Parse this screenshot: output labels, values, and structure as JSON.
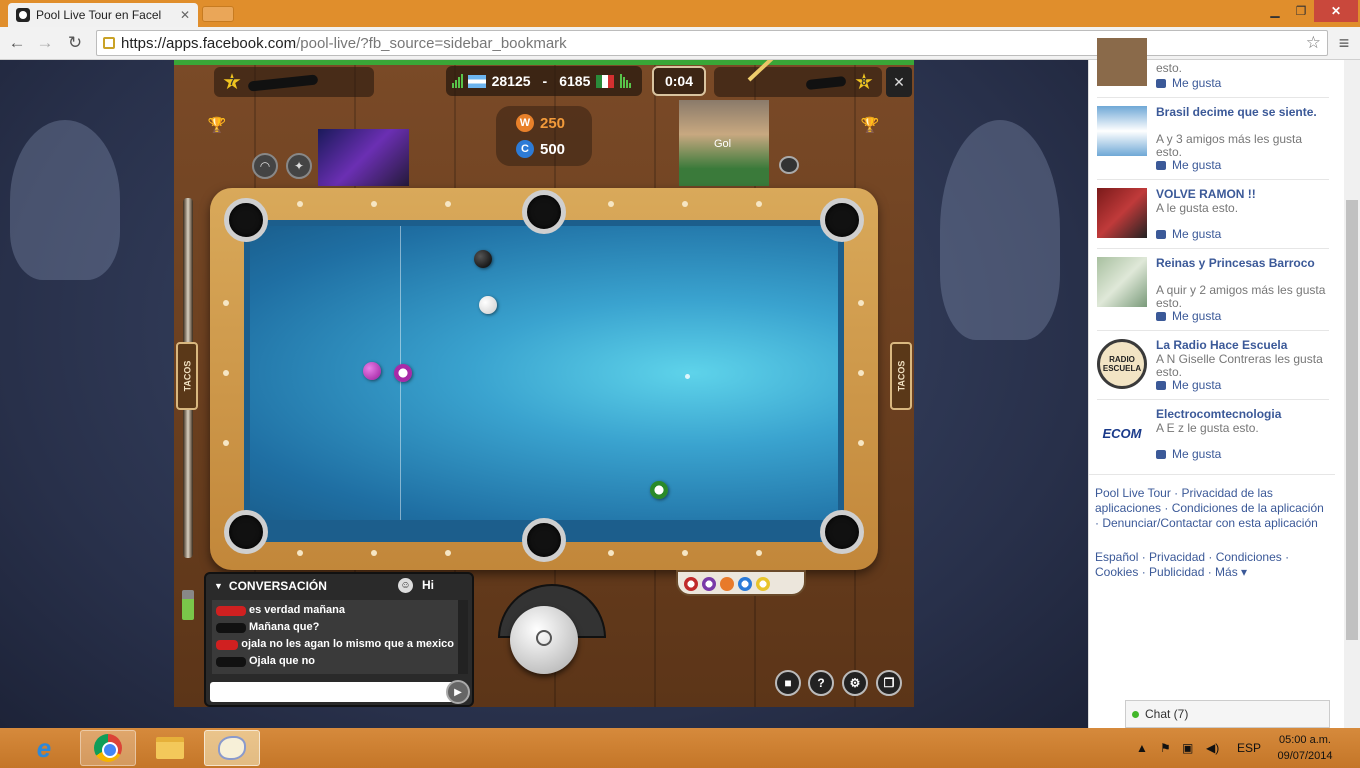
{
  "browser": {
    "tab_title": "Pool Live Tour en Facel",
    "url_host": "https://apps.facebook.com",
    "url_rest": "/pool-live/?fb_source=sidebar_bookmark"
  },
  "game": {
    "player_left_level": "7",
    "player_right_level": "8",
    "score_left": "28125",
    "score_separator": "-",
    "score_right": "6185",
    "timer": "0:04",
    "wins_label": "W",
    "wins_value": "250",
    "coins_label": "C",
    "coins_value": "500",
    "photo_caption": "Gol",
    "left_tab": "TACOS",
    "right_tab": "TACOS",
    "close_label": "✕",
    "chat": {
      "title": "CONVERSACIÓN",
      "hi_label": "Hi",
      "messages": [
        {
          "text": "es verdad mañana"
        },
        {
          "text": "Mañana que?"
        },
        {
          "text": "ojala no les agan lo mismo que a mexico"
        },
        {
          "text": "Ojala que no"
        }
      ]
    },
    "controls": [
      "video-icon",
      "help-icon",
      "settings-icon",
      "window-icon"
    ],
    "colors": {
      "felt": "#3aa3cf",
      "rail": "#d9a95a",
      "wood": "#7a4a27"
    }
  },
  "sidebar": {
    "top_like": "Me gusta",
    "top_snippet": "esto.",
    "items": [
      {
        "title": "Brasil decime que se siente.",
        "desc": "A            y 3 amigos más les gusta esto.",
        "like": "Me gusta"
      },
      {
        "title": "VOLVE RAMON !!",
        "desc": "A                 le gusta esto.",
        "like": "Me gusta"
      },
      {
        "title": "Reinas y Princesas Barroco",
        "desc": "A                  quir y 2 amigos más les gusta esto.",
        "like": "Me gusta"
      },
      {
        "title": "La Radio Hace Escuela",
        "desc": "A N             Giselle Contreras les gusta esto.",
        "like": "Me gusta"
      },
      {
        "title": "Electrocomtecnologia",
        "desc": "A E              z le gusta esto.",
        "like": "Me gusta"
      }
    ],
    "radio_logo_text": "RADIO ESCUELA",
    "ecom_logo_text": "ECOM",
    "footer_links_1": "Pool Live Tour · Privacidad de las aplicaciones · Condiciones de la aplicación · Denunciar/Contactar con esta aplicación",
    "footer_links_2": "Español · Privacidad · Condiciones · Cookies · Publicidad · Más ▾",
    "chat_bar": "Chat (7)"
  },
  "taskbar": {
    "lang": "ESP",
    "time": "05:00 a.m.",
    "date": "09/07/2014"
  }
}
